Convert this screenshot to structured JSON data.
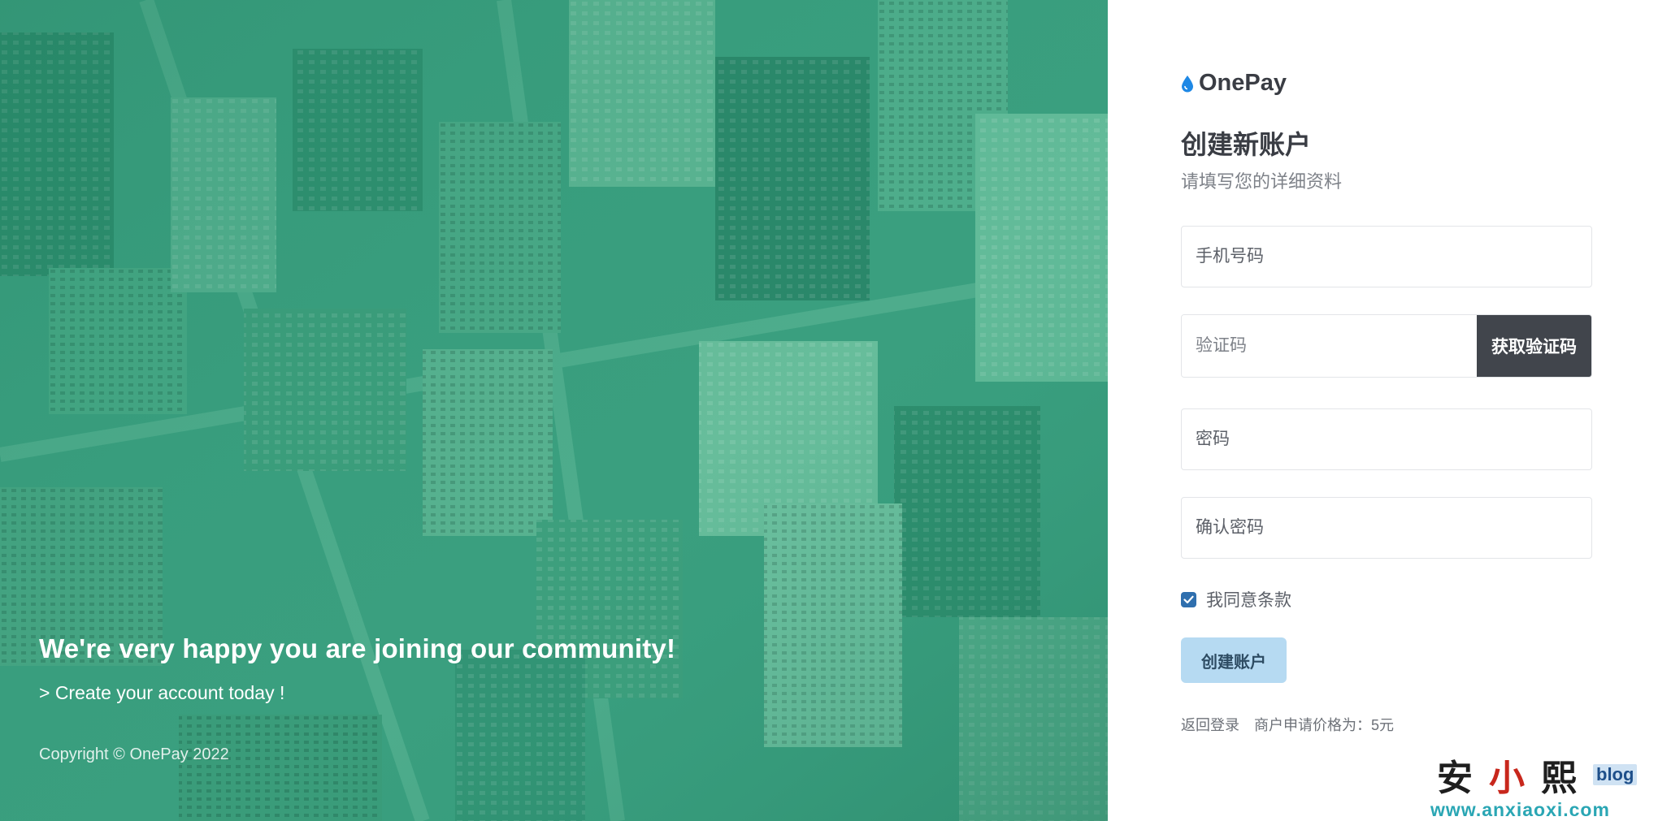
{
  "hero": {
    "title": "We're very happy you are joining our community!",
    "subtitle": "> Create your account today !",
    "copyright": "Copyright © OnePay 2022"
  },
  "brand": {
    "name": "OnePay",
    "icon": "drop-icon",
    "icon_color": "#1e88e5"
  },
  "form": {
    "title": "创建新账户",
    "subtitle": "请填写您的详细资料",
    "phone_placeholder": "手机号码",
    "code_placeholder": "验证码",
    "get_code_label": "获取验证码",
    "password_placeholder": "密码",
    "confirm_placeholder": "确认密码",
    "agree_label": "我同意条款",
    "agree_checked": true,
    "create_label": "创建账户",
    "back_login": "返回登录",
    "price_note": "商户申请价格为：5元"
  },
  "watermark": {
    "chars": [
      "安",
      "小",
      "熙"
    ],
    "badge": "blog",
    "url": "www.anxiaoxi.com"
  },
  "colors": {
    "hero_overlay": "#2f9a78",
    "code_button": "#41454c",
    "create_button": "#b6daf2",
    "checkbox": "#2f6fae"
  }
}
